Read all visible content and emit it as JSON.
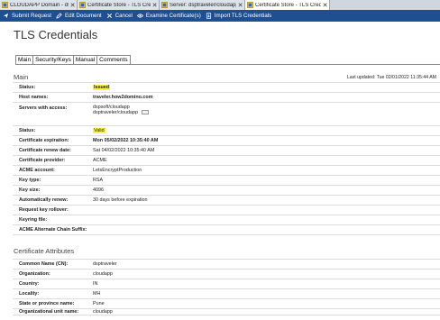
{
  "tabs": [
    {
      "label": "CLOUDAPP Domain - dspsoft...",
      "icon": "domino-icon",
      "active": false
    },
    {
      "label": "Certificate Store - TLS Credential...",
      "icon": "domino-icon",
      "active": false
    },
    {
      "label": "Server: dsptraveler/cloudapp",
      "icon": "domino-icon",
      "active": false
    },
    {
      "label": "Certificate Store - TLS Credential...",
      "icon": "domino-icon",
      "active": true
    }
  ],
  "toolbar": {
    "submit_request": "Submit Request",
    "edit_document": "Edit Document",
    "cancel": "Cancel",
    "examine_certificate": "Examine Certificate(s)",
    "import_tls": "Import TLS Credentials"
  },
  "page_title": "TLS Credentials",
  "section_tabs": [
    "Main",
    "Security/Keys",
    "Manual",
    "Comments"
  ],
  "main_section": {
    "title": "Main",
    "last_updated": "Last updated: Tue 02/01/2022 11:35:44 AM",
    "fields": [
      {
        "label": "Status:",
        "value": "Issued",
        "highlight": true
      },
      {
        "label": "Host names:",
        "value": "traveler.how2domino.com",
        "bold": true
      },
      {
        "label": "Servers with access:",
        "value_lines": [
          "dspsoft/cloudapp",
          "dsptraveler/cloudapp"
        ]
      },
      {
        "label": "Status:",
        "value": "Valid",
        "highlight": true
      },
      {
        "label": "Certificate expiration:",
        "value": "Mon 05/02/2022 10:35:40 AM",
        "bold": true
      },
      {
        "label": "Certificate renew date:",
        "value": "Sat 04/02/2022 10:35:40 AM"
      },
      {
        "label": "Certificate provider:",
        "value": "ACME"
      },
      {
        "label": "ACME account:",
        "value": "LetsEncryptProduction"
      },
      {
        "label": "Key type:",
        "value": "RSA"
      },
      {
        "label": "Key size:",
        "value": "4096"
      },
      {
        "label": "Automatically renew:",
        "value": "30 days before expiration"
      },
      {
        "label": "Request key rollover:",
        "value": ""
      },
      {
        "label": "Keyring file:",
        "value": ""
      },
      {
        "label": "ACME Alternate Chain Suffix:",
        "value": ""
      }
    ]
  },
  "cert_section": {
    "title": "Certificate Attributes",
    "fields": [
      {
        "label": "Common Name (CN):",
        "value": "dsptraveler"
      },
      {
        "label": "Organization:",
        "value": "cloudapp"
      },
      {
        "label": "Country:",
        "value": "IN"
      },
      {
        "label": "Locality:",
        "value": "MH"
      },
      {
        "label": "State or province name:",
        "value": "Pune"
      },
      {
        "label": "Organizational unit name:",
        "value": "cloudapp"
      }
    ]
  },
  "colors": {
    "toolbar_bg": "#1d4f91",
    "highlight": "#fdf24b",
    "tabstrip_bg": "#cfd6e0"
  }
}
